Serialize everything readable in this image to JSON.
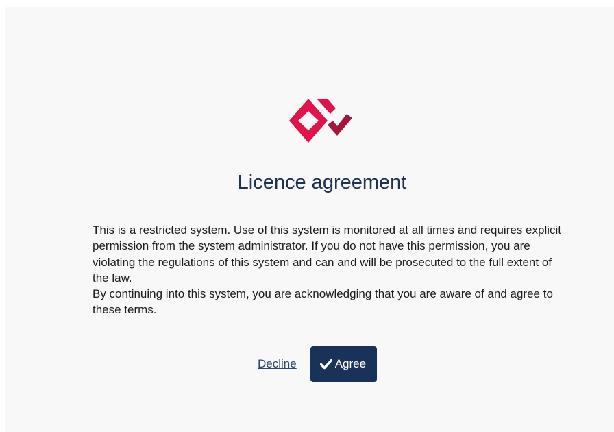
{
  "dialog": {
    "title": "Licence agreement",
    "paragraphs": [
      "This is a restricted system. Use of this system is monitored at all times and requires explicit permission from the system administrator. If you do not have this permission, you are violating the regulations of this system and can and will be prosecuted to the full extent of the law.",
      "By continuing into this system, you are acknowledging that you are aware of and agree to these terms."
    ],
    "decline_label": "Decline",
    "agree_label": "Agree"
  },
  "colors": {
    "logo_diamond": "#e0134a",
    "logo_check": "#a4173d",
    "title": "#1f3250",
    "agree_button": "#19325a",
    "decline_link": "#2c4a6e",
    "panel_background": "#f8f8f8"
  },
  "icons": {
    "logo": "diamond-check-logo",
    "agree": "checkmark-icon"
  }
}
